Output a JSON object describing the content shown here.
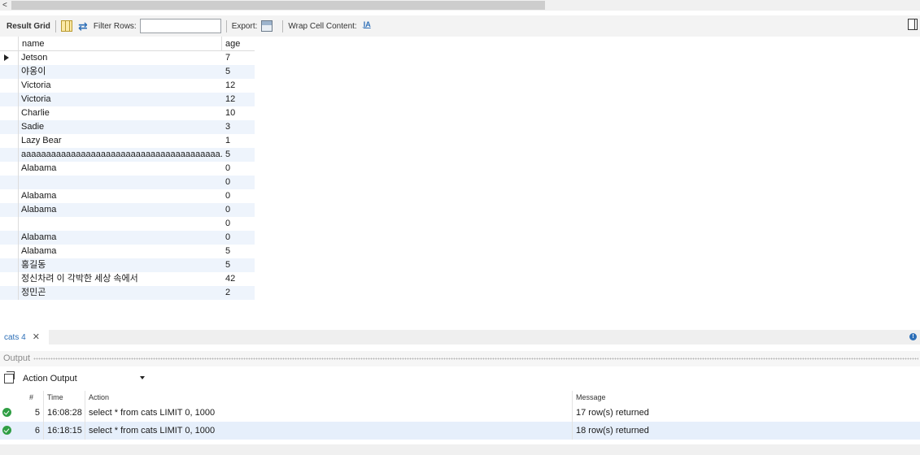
{
  "toolbar": {
    "result_grid": "Result Grid",
    "filter_rows": "Filter Rows:",
    "filter_value": "",
    "export": "Export:",
    "wrap_cell": "Wrap Cell Content:",
    "wrap_icon": "I̲A"
  },
  "grid": {
    "columns": [
      "name",
      "age"
    ],
    "rows": [
      {
        "name": "Jetson",
        "age": "7"
      },
      {
        "name": "야옹이",
        "age": "5"
      },
      {
        "name": "Victoria",
        "age": "12"
      },
      {
        "name": "Victoria",
        "age": "12"
      },
      {
        "name": "Charlie",
        "age": "10"
      },
      {
        "name": "Sadie",
        "age": "3"
      },
      {
        "name": "Lazy Bear",
        "age": "1"
      },
      {
        "name": "aaaaaaaaaaaaaaaaaaaaaaaaaaaaaaaaaaaaaaaa...",
        "age": "5"
      },
      {
        "name": "Alabama",
        "age": "0"
      },
      {
        "name": "",
        "age": "0"
      },
      {
        "name": "Alabama",
        "age": "0"
      },
      {
        "name": "Alabama",
        "age": "0"
      },
      {
        "name": "",
        "age": "0"
      },
      {
        "name": "Alabama",
        "age": "0"
      },
      {
        "name": "Alabama",
        "age": "5"
      },
      {
        "name": "홍길동",
        "age": "5"
      },
      {
        "name": "정신차려 이 각박한 세상 속에서",
        "age": "42"
      },
      {
        "name": "정민곤",
        "age": "2"
      }
    ]
  },
  "tab": {
    "label": "cats 4",
    "close": "✕"
  },
  "output": {
    "title": "Output",
    "selector": "Action Output",
    "columns": {
      "num": "#",
      "time": "Time",
      "action": "Action",
      "message": "Message"
    },
    "rows": [
      {
        "num": "5",
        "time": "16:08:28",
        "action": "select * from cats LIMIT 0, 1000",
        "message": "17 row(s) returned"
      },
      {
        "num": "6",
        "time": "16:18:15",
        "action": "select * from cats LIMIT 0, 1000",
        "message": "18 row(s) returned"
      }
    ]
  },
  "colors": {
    "accent": "#2d6fb7",
    "row_alt": "#eef4fc",
    "success": "#2f9e44"
  }
}
